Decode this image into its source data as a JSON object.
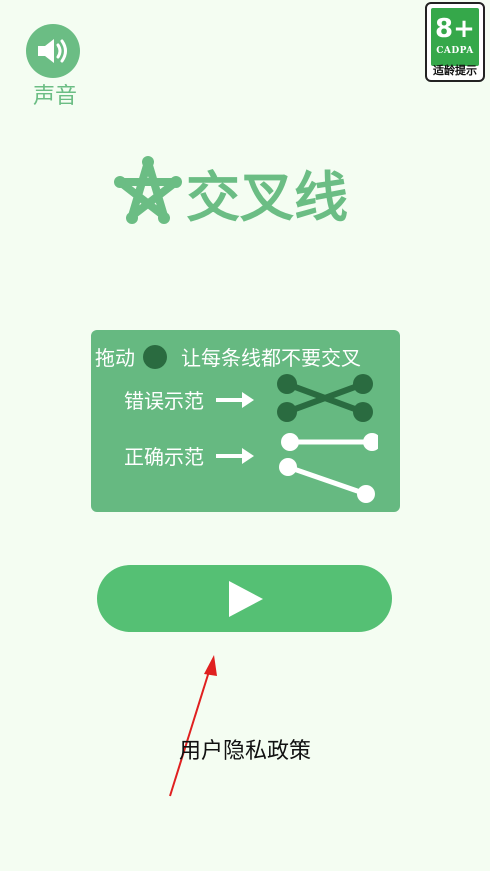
{
  "sound": {
    "icon": "speaker-icon",
    "label": "声音"
  },
  "age_rating": {
    "number": "8+",
    "org": "CADPA",
    "tip": "适龄提示"
  },
  "title": {
    "icon": "star-icon",
    "text": "交叉线"
  },
  "guide": {
    "instruction_prefix": "拖动",
    "instruction_suffix": "让每条线都不要交叉",
    "wrong_label": "错误示范",
    "right_label": "正确示范"
  },
  "play": {
    "icon": "play-icon"
  },
  "footer": {
    "privacy_label": "用户隐私政策"
  },
  "colors": {
    "background": "#f4fdf2",
    "accent": "#6bbd84",
    "panel": "#66b981",
    "dot_dark": "#2a6b40",
    "play_button": "#55c074",
    "badge_green": "#35a84a",
    "annotation": "#e02020"
  }
}
